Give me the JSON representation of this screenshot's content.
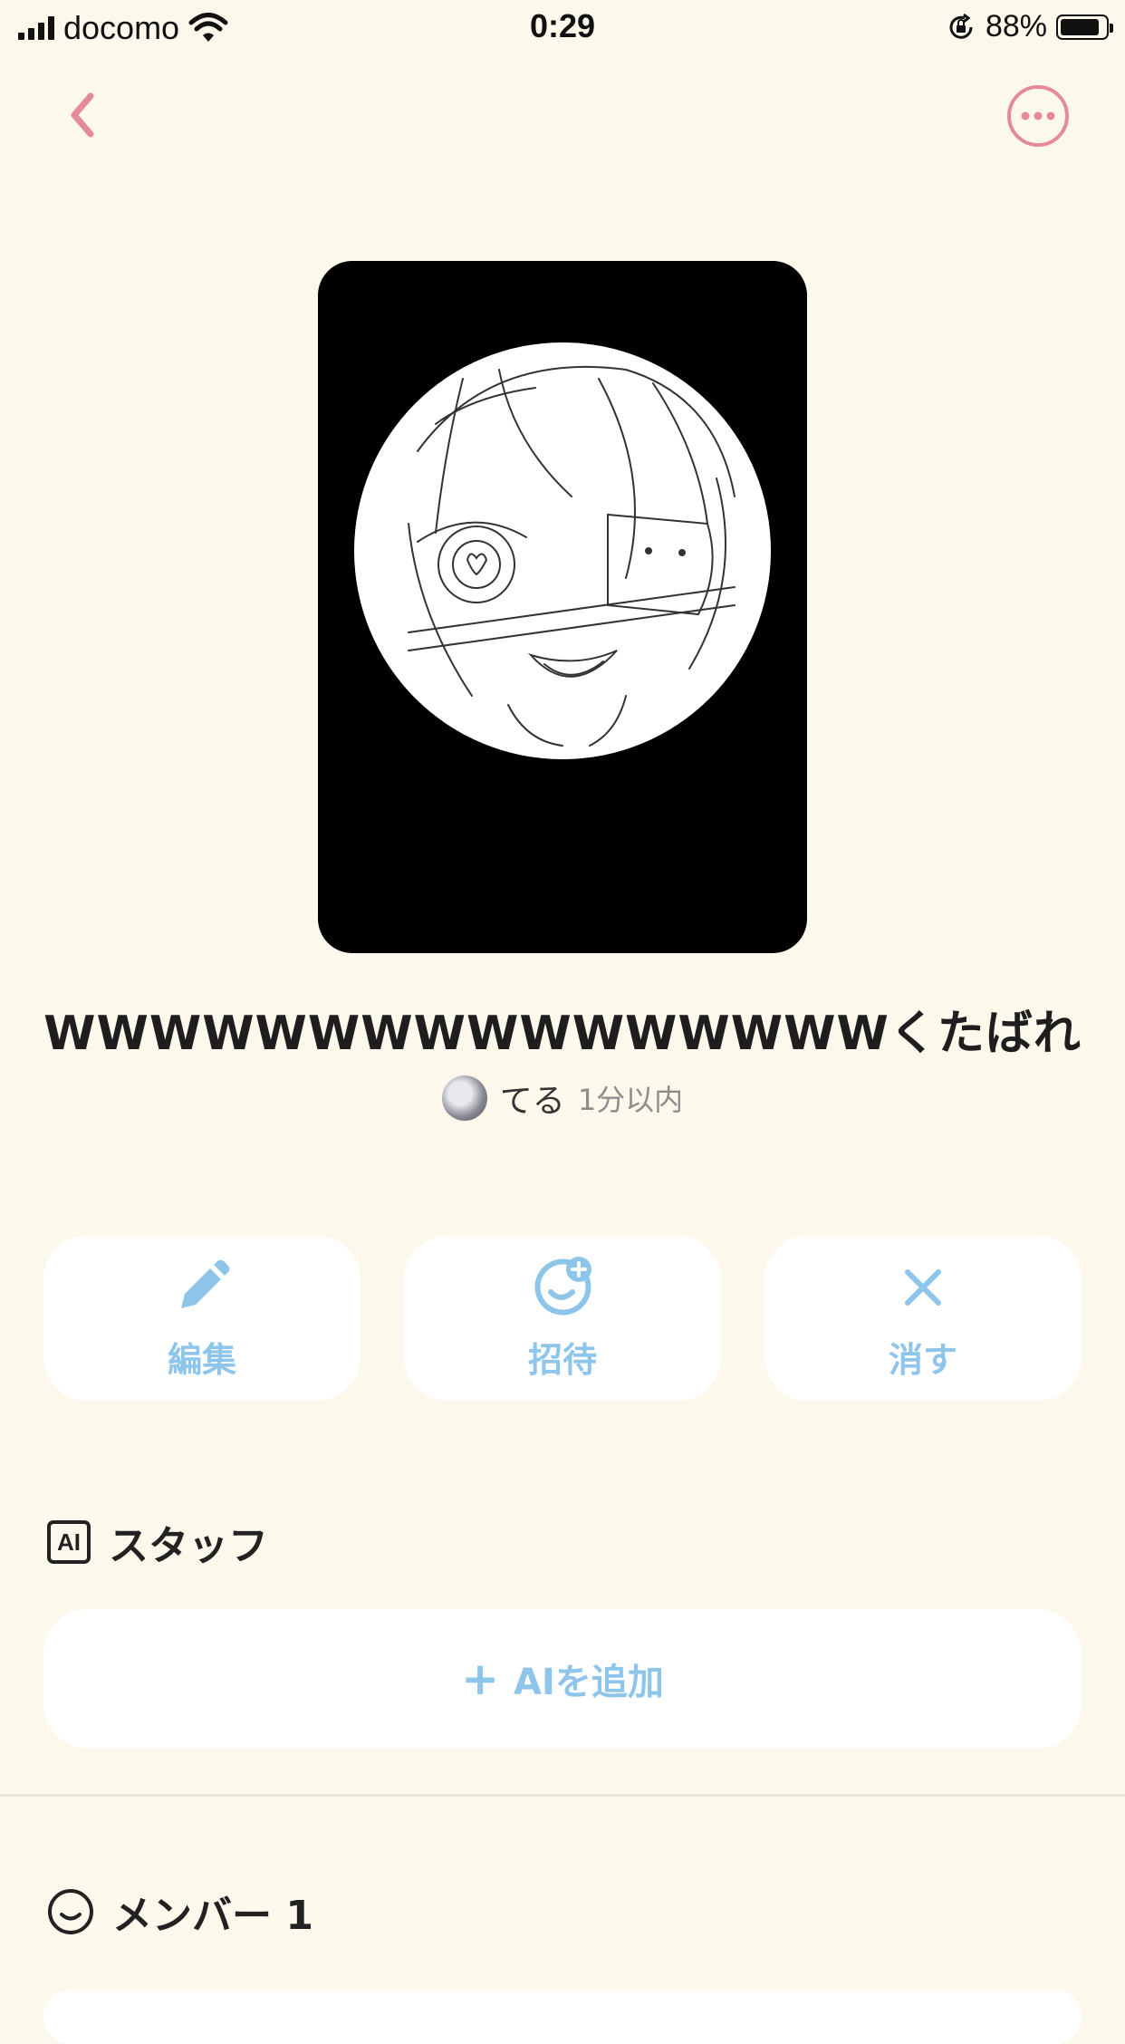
{
  "status_bar": {
    "carrier": "docomo",
    "time": "0:29",
    "battery_percent": "88%",
    "battery_level": 0.88
  },
  "nav": {
    "back_icon": "chevron-left-icon",
    "more_icon": "more-horizontal-circle-icon",
    "accent_color": "#e58a98"
  },
  "room": {
    "title": "WWWWWWWWWWWWWWWWくたばれ",
    "author": {
      "name": "てる",
      "time": "1分以内"
    }
  },
  "actions": [
    {
      "label": "編集",
      "icon": "pencil-icon"
    },
    {
      "label": "招待",
      "icon": "invite-smile-plus-icon"
    },
    {
      "label": "消す",
      "icon": "close-icon"
    }
  ],
  "staff_section": {
    "icon_text": "AI",
    "title": "スタッフ",
    "add_label": "AIを追加",
    "add_icon": "plus-icon"
  },
  "members_section": {
    "icon": "smile-icon",
    "title": "メンバー 1"
  },
  "colors": {
    "background": "#fdf8ec",
    "action_blue": "#8ec5ea",
    "accent_pink": "#e58a98"
  }
}
